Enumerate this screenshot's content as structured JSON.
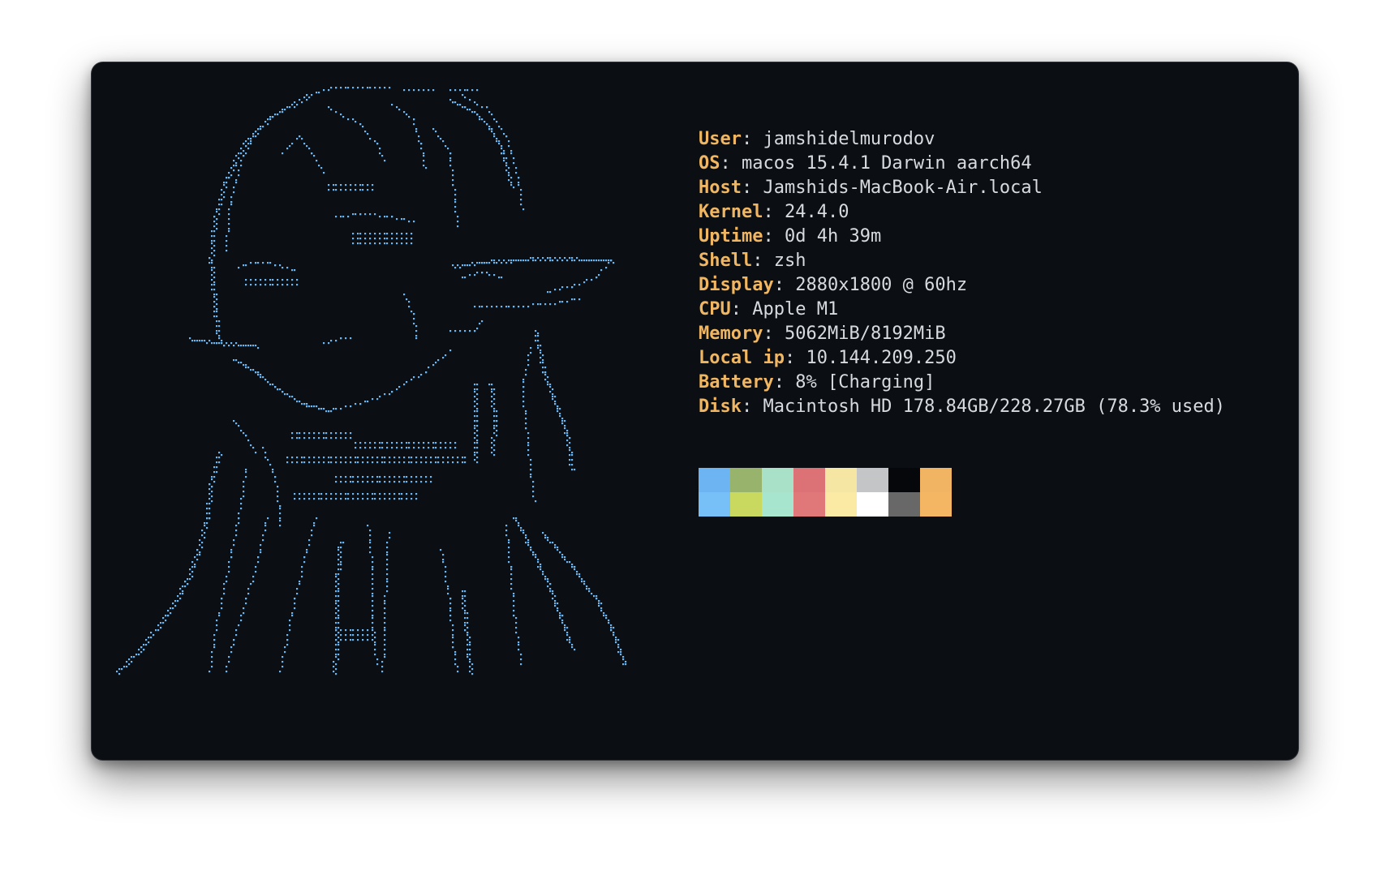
{
  "theme": {
    "label_color": "#f0b661",
    "value_color": "#d7dade",
    "separator_color": "#d7dade",
    "art_color": "#6fb6f0"
  },
  "ascii_art": {
    "description_icon": "portrait-ascii-art"
  },
  "info": {
    "separator": ": ",
    "lines": [
      {
        "label": "User",
        "value": "jamshidelmurodov"
      },
      {
        "label": "OS",
        "value": "macos 15.4.1 Darwin aarch64"
      },
      {
        "label": "Host",
        "value": "Jamshids-MacBook-Air.local"
      },
      {
        "label": "Kernel",
        "value": "24.4.0"
      },
      {
        "label": "Uptime",
        "value": "0d 4h 39m"
      },
      {
        "label": "Shell",
        "value": "zsh"
      },
      {
        "label": "Display",
        "value": "2880x1800 @ 60hz"
      },
      {
        "label": "CPU",
        "value": "Apple M1"
      },
      {
        "label": "Memory",
        "value": "5062MiB/8192MiB"
      },
      {
        "label": "Local ip",
        "value": "10.144.209.250"
      },
      {
        "label": "Battery",
        "value": "8% [Charging]"
      },
      {
        "label": "Disk",
        "value": "Macintosh HD 178.84GB/228.27GB (78.3% used)"
      }
    ]
  },
  "palette": {
    "top": [
      "#6cb5f2",
      "#98b36b",
      "#a8e0c8",
      "#dc7276",
      "#f6e6a4",
      "#c4c5c7",
      "#05070a",
      "#f0b462"
    ],
    "bottom": [
      "#77c0f7",
      "#c9d85e",
      "#a8e5ce",
      "#e0787a",
      "#faeaa4",
      "#ffffff",
      "#686868",
      "#f4b662"
    ]
  }
}
